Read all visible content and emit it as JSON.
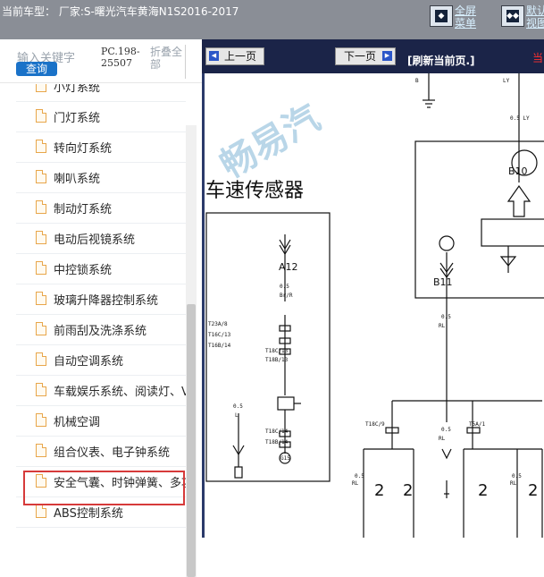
{
  "topbar": {
    "title": "当前车型：  厂家:S-曙光汽车黄海N1S2016-2017",
    "fullscreen_label_1": "全屏",
    "fullscreen_label_2": "菜单",
    "split_label_1": "默认",
    "split_label_2": "视图"
  },
  "search": {
    "placeholder": "输入关键字",
    "query_button": "查询",
    "pc_code": "PC.198-25507",
    "fold_all": "折叠全部"
  },
  "tree": {
    "items": [
      {
        "label": "小灯系统"
      },
      {
        "label": "门灯系统"
      },
      {
        "label": "转向灯系统"
      },
      {
        "label": "喇叭系统"
      },
      {
        "label": "制动灯系统"
      },
      {
        "label": "电动后视镜系统"
      },
      {
        "label": "中控锁系统"
      },
      {
        "label": "玻璃升降器控制系统"
      },
      {
        "label": "前雨刮及洗涤系统"
      },
      {
        "label": "自动空调系统"
      },
      {
        "label": "车载娱乐系统、阅读灯、V"
      },
      {
        "label": "机械空调"
      },
      {
        "label": "组合仪表、电子钟系统"
      },
      {
        "label": "安全气囊、时钟弹簧、多功"
      },
      {
        "label": "ABS控制系统"
      }
    ],
    "selected_index": 12
  },
  "viewer": {
    "prev_page": "上一页",
    "next_page": "下一页",
    "refresh": "[刷新当前页.]",
    "red_char": "当",
    "diagram": {
      "watermark": "畅易汽",
      "heading": "车速传感器",
      "labels": {
        "b": "B",
        "ly": "LY",
        "ly2": "0.5 LY",
        "b10": "B10",
        "b11": "B11",
        "a12": "A12",
        "brr": "Br/R",
        "w05a": "0.5",
        "rl1": "0.5",
        "rl1b": "RL",
        "t18c9": "T18C/9",
        "t5a1": "T5A/1",
        "mid05": "0.5",
        "midrl": "RL",
        "bl05": "0.5",
        "blrl": "RL",
        "br05": "0.5",
        "brrl": "RL",
        "two1": "2",
        "two2": "2",
        "two3": "2",
        "two4": "2",
        "t23a8": "T23A/8",
        "t16c13": "T16C/13",
        "t16b14": "T16B/14",
        "t18c13": "T18C/13",
        "t18b13": "T18B/13",
        "t18c14": "T18C/14",
        "t18b14": "T18B/14",
        "s05": "0.5",
        "sl": "L",
        "g15": "G15"
      }
    }
  }
}
